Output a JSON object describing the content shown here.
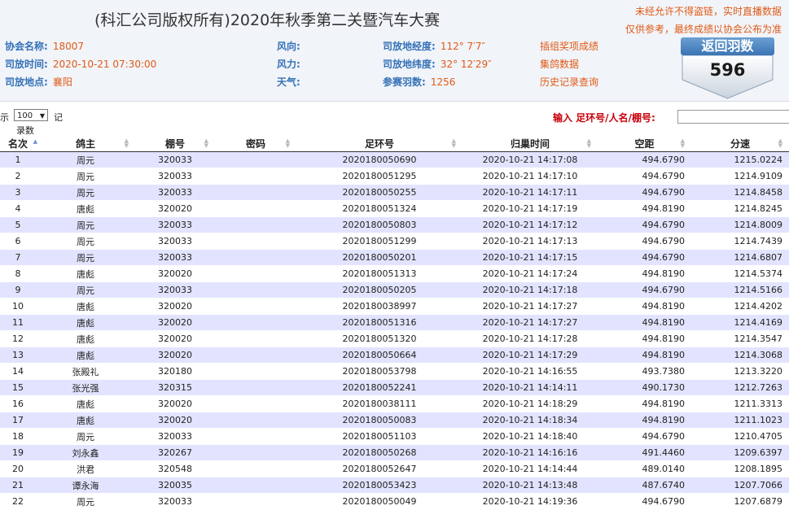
{
  "header": {
    "title": "(科汇公司版权所有)2020年秋季第二关暨汽车大赛",
    "warning1": "未经允许不得盗链，实时直播数据",
    "warning2": "仅供参考，最终成绩以协会公布为准",
    "info": {
      "assoc_label": "协会名称:",
      "assoc_value": "18007",
      "release_time_label": "司放时间:",
      "release_time_value": "2020-10-21 07:30:00",
      "release_place_label": "司放地点:",
      "release_place_value": "襄阳",
      "wind_dir_label": "风向:",
      "wind_dir_value": "",
      "wind_force_label": "风力:",
      "wind_force_value": "",
      "weather_label": "天气:",
      "weather_value": "",
      "lon_label": "司放地经度:",
      "lon_value": "112° 7′7″",
      "lat_label": "司放地纬度:",
      "lat_value": "32° 12′29″",
      "count_label": "参赛羽数:",
      "count_value": "1256"
    },
    "links": {
      "prize": "插组奖项成绩",
      "group": "集鸽数据",
      "history": "历史记录查询"
    },
    "badge": {
      "label": "返回羽数",
      "count": "596"
    }
  },
  "controls": {
    "show_prefix": "示",
    "page_size": "100",
    "show_suffix": "记",
    "show_line2": "录数",
    "search_label": "输入 足环号/人名/棚号:",
    "search_value": ""
  },
  "table": {
    "columns": [
      "名次",
      "鸽主",
      "棚号",
      "密码",
      "足环号",
      "归巢时间",
      "空距",
      "分速"
    ],
    "rows": [
      [
        "1",
        "周元",
        "320033",
        "",
        "2020180050690",
        "2020-10-21 14:17:08",
        "494.6790",
        "1215.0224"
      ],
      [
        "2",
        "周元",
        "320033",
        "",
        "2020180051295",
        "2020-10-21 14:17:10",
        "494.6790",
        "1214.9109"
      ],
      [
        "3",
        "周元",
        "320033",
        "",
        "2020180050255",
        "2020-10-21 14:17:11",
        "494.6790",
        "1214.8458"
      ],
      [
        "4",
        "唐彪",
        "320020",
        "",
        "2020180051324",
        "2020-10-21 14:17:19",
        "494.8190",
        "1214.8245"
      ],
      [
        "5",
        "周元",
        "320033",
        "",
        "2020180050803",
        "2020-10-21 14:17:12",
        "494.6790",
        "1214.8009"
      ],
      [
        "6",
        "周元",
        "320033",
        "",
        "2020180051299",
        "2020-10-21 14:17:13",
        "494.6790",
        "1214.7439"
      ],
      [
        "7",
        "周元",
        "320033",
        "",
        "2020180050201",
        "2020-10-21 14:17:15",
        "494.6790",
        "1214.6807"
      ],
      [
        "8",
        "唐彪",
        "320020",
        "",
        "2020180051313",
        "2020-10-21 14:17:24",
        "494.8190",
        "1214.5374"
      ],
      [
        "9",
        "周元",
        "320033",
        "",
        "2020180050205",
        "2020-10-21 14:17:18",
        "494.6790",
        "1214.5166"
      ],
      [
        "10",
        "唐彪",
        "320020",
        "",
        "2020180038997",
        "2020-10-21 14:17:27",
        "494.8190",
        "1214.4202"
      ],
      [
        "11",
        "唐彪",
        "320020",
        "",
        "2020180051316",
        "2020-10-21 14:17:27",
        "494.8190",
        "1214.4169"
      ],
      [
        "12",
        "唐彪",
        "320020",
        "",
        "2020180051320",
        "2020-10-21 14:17:28",
        "494.8190",
        "1214.3547"
      ],
      [
        "13",
        "唐彪",
        "320020",
        "",
        "2020180050664",
        "2020-10-21 14:17:29",
        "494.8190",
        "1214.3068"
      ],
      [
        "14",
        "张殿礼",
        "320180",
        "",
        "2020180053798",
        "2020-10-21 14:16:55",
        "493.7380",
        "1213.3220"
      ],
      [
        "15",
        "张光强",
        "320315",
        "",
        "2020180052241",
        "2020-10-21 14:14:11",
        "490.1730",
        "1212.7263"
      ],
      [
        "16",
        "唐彪",
        "320020",
        "",
        "2020180038111",
        "2020-10-21 14:18:29",
        "494.8190",
        "1211.3313"
      ],
      [
        "17",
        "唐彪",
        "320020",
        "",
        "2020180050083",
        "2020-10-21 14:18:34",
        "494.8190",
        "1211.1023"
      ],
      [
        "18",
        "周元",
        "320033",
        "",
        "2020180051103",
        "2020-10-21 14:18:40",
        "494.6790",
        "1210.4705"
      ],
      [
        "19",
        "刘永鑫",
        "320267",
        "",
        "2020180050268",
        "2020-10-21 14:16:16",
        "491.4460",
        "1209.6397"
      ],
      [
        "20",
        "洪君",
        "320548",
        "",
        "2020180052647",
        "2020-10-21 14:14:44",
        "489.0140",
        "1208.1895"
      ],
      [
        "21",
        "谭永海",
        "320035",
        "",
        "2020180053423",
        "2020-10-21 14:13:48",
        "487.6740",
        "1207.7066"
      ],
      [
        "22",
        "周元",
        "320033",
        "",
        "2020180050049",
        "2020-10-21 14:19:36",
        "494.6790",
        "1207.6879"
      ]
    ]
  },
  "colors": {
    "title": "#333333",
    "warning": "#e05a16",
    "label": "#3471b6",
    "search": "#c8000a",
    "row_odd": "#e2e4ff",
    "badge": "#3a74b5"
  },
  "icons": {
    "sort": "sort-arrows-icon",
    "sort_active": "sort-ascending-icon",
    "badge": "shield-badge-icon"
  }
}
